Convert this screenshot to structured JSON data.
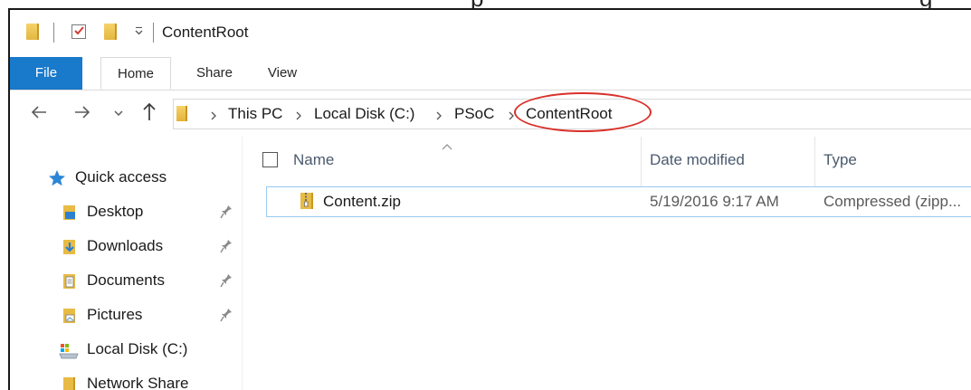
{
  "window": {
    "title": "ContentRoot"
  },
  "ribbon": {
    "tabs": [
      "File",
      "Home",
      "Share",
      "View"
    ]
  },
  "breadcrumb": [
    "This PC",
    "Local Disk (C:)",
    "PSoC",
    "ContentRoot"
  ],
  "nav_pane": {
    "items": [
      {
        "label": "Quick access",
        "icon": "star-icon",
        "pinned": false
      },
      {
        "label": "Desktop",
        "icon": "desktop-folder-icon",
        "pinned": true
      },
      {
        "label": "Downloads",
        "icon": "downloads-folder-icon",
        "pinned": true
      },
      {
        "label": "Documents",
        "icon": "documents-folder-icon",
        "pinned": true
      },
      {
        "label": "Pictures",
        "icon": "pictures-folder-icon",
        "pinned": true
      },
      {
        "label": "Local Disk (C:)",
        "icon": "drive-icon",
        "pinned": false
      },
      {
        "label": "Network Share",
        "icon": "folder-icon",
        "pinned": false
      }
    ]
  },
  "file_list": {
    "columns": [
      "Name",
      "Date modified",
      "Type"
    ],
    "rows": [
      {
        "name": "Content.zip",
        "date_modified": "5/19/2016 9:17 AM",
        "type": "Compressed (zipp...",
        "icon": "zip-folder-icon"
      }
    ]
  },
  "colors": {
    "file_tab": "#1979ca",
    "highlight": "#d9302a",
    "selection_border": "#99c9ef",
    "folder": "#e8bb45"
  }
}
